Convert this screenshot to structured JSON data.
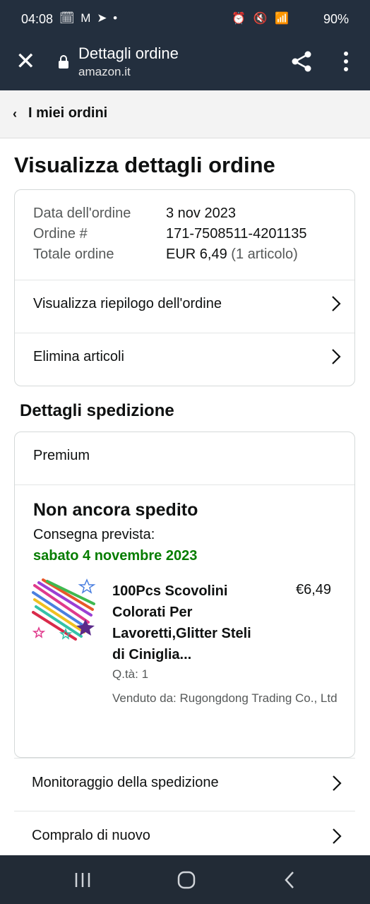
{
  "status_bar": {
    "time": "04:08",
    "left_icons": "🗓 M ➤ •",
    "right_icons": "⏰ 🔇 📶",
    "battery": "90%"
  },
  "browser": {
    "title": "Dettagli ordine",
    "domain": "amazon.it",
    "close_icon": "close-icon",
    "share_icon": "share-icon",
    "menu_icon": "more-vert-icon"
  },
  "breadcrumb": {
    "label": "I miei ordini"
  },
  "page_title": "Visualizza dettagli ordine",
  "order_info": {
    "date_label": "Data dell'ordine",
    "date_value": "3 nov 2023",
    "number_label": "Ordine #",
    "number_value": "171-7508511-4201135",
    "total_label": "Totale ordine",
    "total_value": "EUR 6,49",
    "total_items": "(1 articolo)"
  },
  "order_links": [
    {
      "label": "Visualizza riepilogo dell'ordine"
    },
    {
      "label": "Elimina articoli"
    }
  ],
  "shipment": {
    "heading": "Dettagli spedizione",
    "type": "Premium",
    "status": "Non ancora spedito",
    "eta_label": "Consegna prevista:",
    "eta_date": "sabato 4 novembre 2023",
    "item": {
      "name": "100Pcs Scovolini Colorati Per Lavoretti,Glitter Steli di Ciniglia...",
      "price": "€6,49",
      "qty": "Q.tà: 1",
      "seller": "Venduto da: Rugongdong Trading Co., Ltd"
    }
  },
  "shipment_links": [
    {
      "label": "Monitoraggio della spedizione"
    },
    {
      "label": "Compralo di nuovo"
    }
  ],
  "colors": {
    "header_bg": "#232f3e",
    "delivery_green": "#067d00",
    "nav_bg": "#222b36"
  }
}
